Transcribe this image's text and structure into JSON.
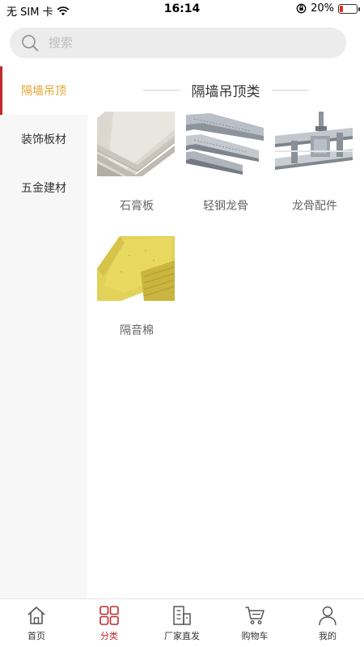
{
  "status_bar": {
    "carrier": "无 SIM 卡",
    "time": "16:14",
    "battery": "20%",
    "battery_level": 0.2,
    "battery_color": "#e0302a"
  },
  "search": {
    "placeholder": "搜索"
  },
  "sidebar": {
    "items": [
      {
        "label": "隔墙吊顶",
        "active": true
      },
      {
        "label": "装饰板材",
        "active": false
      },
      {
        "label": "五金建材",
        "active": false
      }
    ]
  },
  "content": {
    "title": "隔墙吊顶类",
    "products": [
      {
        "name": "石膏板",
        "image": "gypsum-board"
      },
      {
        "name": "轻钢龙骨",
        "image": "light-steel-keel"
      },
      {
        "name": "龙骨配件",
        "image": "keel-accessories"
      },
      {
        "name": "隔音棉",
        "image": "soundproof-cotton"
      }
    ]
  },
  "bottom_nav": {
    "items": [
      {
        "label": "首页",
        "icon": "home-icon",
        "active": false
      },
      {
        "label": "分类",
        "icon": "category-icon",
        "active": true
      },
      {
        "label": "厂家直发",
        "icon": "factory-icon",
        "active": false
      },
      {
        "label": "购物车",
        "icon": "cart-icon",
        "active": false
      },
      {
        "label": "我的",
        "icon": "user-icon",
        "active": false
      }
    ]
  },
  "colors": {
    "accent_red": "#c02b2b",
    "active_text": "#e5a32f"
  }
}
